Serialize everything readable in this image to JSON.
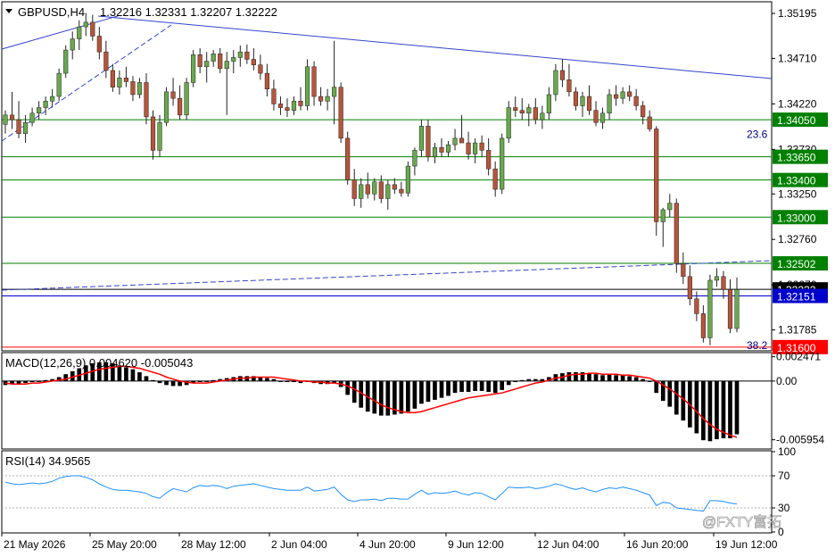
{
  "header": {
    "symbol_tf": "GBPUSD,H4",
    "ohlc": "1.32216 1.32331 1.32207 1.32222"
  },
  "watermark": {
    "text": "@FXTY富拓"
  },
  "chart_data": [
    {
      "type": "candlestick",
      "symbol": "GBPUSD",
      "timeframe": "H4",
      "open": 1.32216,
      "high": 1.32331,
      "low": 1.32207,
      "close": 1.32222,
      "ylim": [
        1.3156,
        1.3532
      ],
      "price_axis_ticks": [
        "1.35195",
        "1.34710",
        "1.34220",
        "1.33730",
        "1.33250",
        "1.32760",
        "1.32270",
        "1.31785"
      ],
      "time_axis_labels": [
        "21 May 2026",
        "25 May 20:00",
        "28 May 12:00",
        "2 Jun 04:00",
        "4 Jun 20:00",
        "9 Jun 12:00",
        "12 Jun 04:00",
        "16 Jun 20:00",
        "19 Jun 12:00"
      ],
      "candles": [
        {
          "o": 1.34,
          "h": 1.3415,
          "l": 1.339,
          "c": 1.341
        },
        {
          "o": 1.341,
          "h": 1.3435,
          "l": 1.3395,
          "c": 1.3405
        },
        {
          "o": 1.3405,
          "h": 1.3425,
          "l": 1.3385,
          "c": 1.339
        },
        {
          "o": 1.339,
          "h": 1.341,
          "l": 1.338,
          "c": 1.3402
        },
        {
          "o": 1.3402,
          "h": 1.3418,
          "l": 1.3398,
          "c": 1.3412
        },
        {
          "o": 1.3412,
          "h": 1.3425,
          "l": 1.3405,
          "c": 1.3418
        },
        {
          "o": 1.3418,
          "h": 1.343,
          "l": 1.341,
          "c": 1.3425
        },
        {
          "o": 1.3425,
          "h": 1.3438,
          "l": 1.3418,
          "c": 1.343
        },
        {
          "o": 1.343,
          "h": 1.346,
          "l": 1.3425,
          "c": 1.3455
        },
        {
          "o": 1.3455,
          "h": 1.3485,
          "l": 1.345,
          "c": 1.348
        },
        {
          "o": 1.348,
          "h": 1.35,
          "l": 1.347,
          "c": 1.3492
        },
        {
          "o": 1.3492,
          "h": 1.3512,
          "l": 1.348,
          "c": 1.3505
        },
        {
          "o": 1.3505,
          "h": 1.352,
          "l": 1.3495,
          "c": 1.351
        },
        {
          "o": 1.351,
          "h": 1.3518,
          "l": 1.349,
          "c": 1.3495
        },
        {
          "o": 1.3495,
          "h": 1.3505,
          "l": 1.347,
          "c": 1.3478
        },
        {
          "o": 1.3478,
          "h": 1.349,
          "l": 1.345,
          "c": 1.3458
        },
        {
          "o": 1.3458,
          "h": 1.3465,
          "l": 1.3435,
          "c": 1.344
        },
        {
          "o": 1.344,
          "h": 1.3458,
          "l": 1.3432,
          "c": 1.345
        },
        {
          "o": 1.345,
          "h": 1.3462,
          "l": 1.344,
          "c": 1.3446
        },
        {
          "o": 1.3446,
          "h": 1.3452,
          "l": 1.3425,
          "c": 1.3432
        },
        {
          "o": 1.3432,
          "h": 1.345,
          "l": 1.3428,
          "c": 1.3445
        },
        {
          "o": 1.3445,
          "h": 1.3455,
          "l": 1.34,
          "c": 1.3408
        },
        {
          "o": 1.3408,
          "h": 1.3415,
          "l": 1.3362,
          "c": 1.3372
        },
        {
          "o": 1.3372,
          "h": 1.341,
          "l": 1.3365,
          "c": 1.3402
        },
        {
          "o": 1.3402,
          "h": 1.344,
          "l": 1.3398,
          "c": 1.3435
        },
        {
          "o": 1.3435,
          "h": 1.345,
          "l": 1.342,
          "c": 1.3428
        },
        {
          "o": 1.3428,
          "h": 1.3442,
          "l": 1.3405,
          "c": 1.341
        },
        {
          "o": 1.341,
          "h": 1.345,
          "l": 1.3405,
          "c": 1.3445
        },
        {
          "o": 1.3445,
          "h": 1.348,
          "l": 1.344,
          "c": 1.3475
        },
        {
          "o": 1.3475,
          "h": 1.3482,
          "l": 1.3455,
          "c": 1.3462
        },
        {
          "o": 1.3462,
          "h": 1.3478,
          "l": 1.3445,
          "c": 1.3468
        },
        {
          "o": 1.3468,
          "h": 1.348,
          "l": 1.3462,
          "c": 1.3476
        },
        {
          "o": 1.3476,
          "h": 1.3482,
          "l": 1.3455,
          "c": 1.346
        },
        {
          "o": 1.346,
          "h": 1.3478,
          "l": 1.341,
          "c": 1.3468
        },
        {
          "o": 1.3468,
          "h": 1.348,
          "l": 1.3455,
          "c": 1.3472
        },
        {
          "o": 1.3472,
          "h": 1.3485,
          "l": 1.3462,
          "c": 1.3478
        },
        {
          "o": 1.3478,
          "h": 1.3486,
          "l": 1.3465,
          "c": 1.347
        },
        {
          "o": 1.347,
          "h": 1.3482,
          "l": 1.3458,
          "c": 1.3464
        },
        {
          "o": 1.3464,
          "h": 1.3475,
          "l": 1.3448,
          "c": 1.3455
        },
        {
          "o": 1.3455,
          "h": 1.3465,
          "l": 1.343,
          "c": 1.3438
        },
        {
          "o": 1.3438,
          "h": 1.3448,
          "l": 1.3415,
          "c": 1.3422
        },
        {
          "o": 1.3422,
          "h": 1.343,
          "l": 1.341,
          "c": 1.3418
        },
        {
          "o": 1.3418,
          "h": 1.3428,
          "l": 1.3408,
          "c": 1.3415
        },
        {
          "o": 1.3415,
          "h": 1.343,
          "l": 1.341,
          "c": 1.3425
        },
        {
          "o": 1.3425,
          "h": 1.344,
          "l": 1.3415,
          "c": 1.342
        },
        {
          "o": 1.342,
          "h": 1.347,
          "l": 1.3415,
          "c": 1.3462
        },
        {
          "o": 1.3462,
          "h": 1.3468,
          "l": 1.342,
          "c": 1.343
        },
        {
          "o": 1.343,
          "h": 1.344,
          "l": 1.342,
          "c": 1.3425
        },
        {
          "o": 1.3425,
          "h": 1.3438,
          "l": 1.3415,
          "c": 1.343
        },
        {
          "o": 1.343,
          "h": 1.349,
          "l": 1.34,
          "c": 1.344
        },
        {
          "o": 1.344,
          "h": 1.3445,
          "l": 1.338,
          "c": 1.3385
        },
        {
          "o": 1.3385,
          "h": 1.3392,
          "l": 1.3335,
          "c": 1.334
        },
        {
          "o": 1.334,
          "h": 1.3352,
          "l": 1.3312,
          "c": 1.332
        },
        {
          "o": 1.332,
          "h": 1.3342,
          "l": 1.331,
          "c": 1.3335
        },
        {
          "o": 1.3335,
          "h": 1.3348,
          "l": 1.332,
          "c": 1.3325
        },
        {
          "o": 1.3325,
          "h": 1.3342,
          "l": 1.3318,
          "c": 1.3338
        },
        {
          "o": 1.3338,
          "h": 1.3345,
          "l": 1.3315,
          "c": 1.332
        },
        {
          "o": 1.332,
          "h": 1.334,
          "l": 1.3308,
          "c": 1.3335
        },
        {
          "o": 1.3335,
          "h": 1.3342,
          "l": 1.3325,
          "c": 1.333
        },
        {
          "o": 1.333,
          "h": 1.3338,
          "l": 1.3322,
          "c": 1.3326
        },
        {
          "o": 1.3326,
          "h": 1.336,
          "l": 1.3322,
          "c": 1.3355
        },
        {
          "o": 1.3355,
          "h": 1.3375,
          "l": 1.3345,
          "c": 1.3372
        },
        {
          "o": 1.3372,
          "h": 1.3405,
          "l": 1.3365,
          "c": 1.3398
        },
        {
          "o": 1.3398,
          "h": 1.3405,
          "l": 1.336,
          "c": 1.3365
        },
        {
          "o": 1.3365,
          "h": 1.338,
          "l": 1.3358,
          "c": 1.3375
        },
        {
          "o": 1.3375,
          "h": 1.3385,
          "l": 1.3365,
          "c": 1.337
        },
        {
          "o": 1.337,
          "h": 1.3382,
          "l": 1.3365,
          "c": 1.3378
        },
        {
          "o": 1.3378,
          "h": 1.3395,
          "l": 1.3372,
          "c": 1.3385
        },
        {
          "o": 1.3385,
          "h": 1.341,
          "l": 1.338,
          "c": 1.338
        },
        {
          "o": 1.338,
          "h": 1.3392,
          "l": 1.3362,
          "c": 1.3368
        },
        {
          "o": 1.3368,
          "h": 1.3385,
          "l": 1.3358,
          "c": 1.338
        },
        {
          "o": 1.338,
          "h": 1.3388,
          "l": 1.3365,
          "c": 1.3372
        },
        {
          "o": 1.3372,
          "h": 1.3385,
          "l": 1.3345,
          "c": 1.3352
        },
        {
          "o": 1.3352,
          "h": 1.336,
          "l": 1.3322,
          "c": 1.333
        },
        {
          "o": 1.333,
          "h": 1.339,
          "l": 1.3325,
          "c": 1.3385
        },
        {
          "o": 1.3385,
          "h": 1.3425,
          "l": 1.338,
          "c": 1.3418
        },
        {
          "o": 1.3418,
          "h": 1.343,
          "l": 1.3408,
          "c": 1.3415
        },
        {
          "o": 1.3415,
          "h": 1.3428,
          "l": 1.3405,
          "c": 1.3412
        },
        {
          "o": 1.3412,
          "h": 1.3422,
          "l": 1.3398,
          "c": 1.3418
        },
        {
          "o": 1.3418,
          "h": 1.3428,
          "l": 1.34,
          "c": 1.3405
        },
        {
          "o": 1.3405,
          "h": 1.342,
          "l": 1.3395,
          "c": 1.3412
        },
        {
          "o": 1.3412,
          "h": 1.344,
          "l": 1.3405,
          "c": 1.3432
        },
        {
          "o": 1.3432,
          "h": 1.3465,
          "l": 1.3425,
          "c": 1.3458
        },
        {
          "o": 1.3458,
          "h": 1.347,
          "l": 1.344,
          "c": 1.3448
        },
        {
          "o": 1.3448,
          "h": 1.3465,
          "l": 1.343,
          "c": 1.3435
        },
        {
          "o": 1.3435,
          "h": 1.344,
          "l": 1.3415,
          "c": 1.342
        },
        {
          "o": 1.342,
          "h": 1.3435,
          "l": 1.3408,
          "c": 1.343
        },
        {
          "o": 1.343,
          "h": 1.3442,
          "l": 1.341,
          "c": 1.3415
        },
        {
          "o": 1.3415,
          "h": 1.3425,
          "l": 1.3398,
          "c": 1.3402
        },
        {
          "o": 1.3402,
          "h": 1.3418,
          "l": 1.3395,
          "c": 1.3412
        },
        {
          "o": 1.3412,
          "h": 1.3438,
          "l": 1.3405,
          "c": 1.3432
        },
        {
          "o": 1.3432,
          "h": 1.3442,
          "l": 1.342,
          "c": 1.3428
        },
        {
          "o": 1.3428,
          "h": 1.344,
          "l": 1.3422,
          "c": 1.3435
        },
        {
          "o": 1.3435,
          "h": 1.3442,
          "l": 1.3425,
          "c": 1.343
        },
        {
          "o": 1.343,
          "h": 1.3438,
          "l": 1.3415,
          "c": 1.342
        },
        {
          "o": 1.342,
          "h": 1.3425,
          "l": 1.34,
          "c": 1.3408
        },
        {
          "o": 1.3408,
          "h": 1.3415,
          "l": 1.3392,
          "c": 1.3395
        },
        {
          "o": 1.3395,
          "h": 1.3398,
          "l": 1.328,
          "c": 1.3295
        },
        {
          "o": 1.3295,
          "h": 1.331,
          "l": 1.3268,
          "c": 1.3308
        },
        {
          "o": 1.3308,
          "h": 1.3325,
          "l": 1.33,
          "c": 1.3315
        },
        {
          "o": 1.3315,
          "h": 1.332,
          "l": 1.324,
          "c": 1.325
        },
        {
          "o": 1.325,
          "h": 1.3262,
          "l": 1.3228,
          "c": 1.3236
        },
        {
          "o": 1.3236,
          "h": 1.3248,
          "l": 1.3205,
          "c": 1.3212
        },
        {
          "o": 1.3212,
          "h": 1.322,
          "l": 1.3188,
          "c": 1.3196
        },
        {
          "o": 1.3196,
          "h": 1.3205,
          "l": 1.3165,
          "c": 1.317
        },
        {
          "o": 1.317,
          "h": 1.3238,
          "l": 1.3162,
          "c": 1.3232
        },
        {
          "o": 1.3232,
          "h": 1.3245,
          "l": 1.3225,
          "c": 1.3236
        },
        {
          "o": 1.3236,
          "h": 1.3242,
          "l": 1.3212,
          "c": 1.3222
        },
        {
          "o": 1.3222,
          "h": 1.3233,
          "l": 1.3175,
          "c": 1.318
        },
        {
          "o": 1.318,
          "h": 1.3235,
          "l": 1.3176,
          "c": 1.3222
        }
      ],
      "horizontal_levels": [
        {
          "price": 1.3405,
          "label": "1.34050",
          "color": "#008000"
        },
        {
          "price": 1.3365,
          "label": "1.33650",
          "color": "#008000"
        },
        {
          "price": 1.334,
          "label": "1.33400",
          "color": "#008000"
        },
        {
          "price": 1.33,
          "label": "1.33000",
          "color": "#008000"
        },
        {
          "price": 1.32502,
          "label": "1.32502",
          "color": "#008000"
        },
        {
          "price": 1.32222,
          "label": "1.32222",
          "color": "#000000"
        },
        {
          "price": 1.32151,
          "label": "1.32151",
          "color": "#0000cc"
        },
        {
          "price": 1.316,
          "label": "1.31600",
          "color": "#ff0000"
        }
      ],
      "fib_labels": [
        {
          "text": "23.6",
          "price": 1.3389
        },
        {
          "text": "38.2",
          "price": 1.3156
        }
      ],
      "colors": {
        "bull": "#6aa84f",
        "bear": "#b5553a",
        "trend": "#3344cc"
      }
    },
    {
      "type": "macd",
      "title": "MACD(12,26,9) 0.004620 -0.005043",
      "axis_labels": [
        "0.002471",
        "0.00",
        "-0.005954"
      ],
      "ylim": [
        -0.0068,
        0.0028
      ],
      "histogram": [
        -0.0004,
        -0.0003,
        -0.0003,
        -0.0002,
        -0.0001,
        0.0,
        0.0001,
        0.0002,
        0.0004,
        0.0007,
        0.001,
        0.0013,
        0.0016,
        0.0018,
        0.0019,
        0.0019,
        0.0018,
        0.0016,
        0.0014,
        0.0012,
        0.0009,
        0.0005,
        0.0001,
        -0.0002,
        -0.0004,
        -0.0005,
        -0.0005,
        -0.0004,
        -0.0002,
        -0.0001,
        0.0,
        0.0001,
        0.0002,
        0.0003,
        0.0004,
        0.0005,
        0.0005,
        0.0005,
        0.0004,
        0.0003,
        0.0002,
        0.0,
        -0.0001,
        -0.0001,
        -0.0002,
        -0.0001,
        -0.0002,
        -0.0003,
        -0.0003,
        -0.0002,
        -0.0006,
        -0.0014,
        -0.0022,
        -0.0027,
        -0.0031,
        -0.0033,
        -0.0035,
        -0.0035,
        -0.0034,
        -0.0033,
        -0.0031,
        -0.0028,
        -0.0023,
        -0.0021,
        -0.0019,
        -0.0017,
        -0.0015,
        -0.0012,
        -0.0011,
        -0.0011,
        -0.001,
        -0.001,
        -0.0011,
        -0.0012,
        -0.0009,
        -0.0004,
        -0.0001,
        0.0001,
        0.0002,
        0.0002,
        0.0002,
        0.0004,
        0.0007,
        0.0008,
        0.0009,
        0.0009,
        0.0009,
        0.0008,
        0.0007,
        0.0006,
        0.0007,
        0.0006,
        0.0006,
        0.0005,
        0.0004,
        0.0002,
        0.0,
        -0.0012,
        -0.002,
        -0.0026,
        -0.0034,
        -0.004,
        -0.0047,
        -0.0053,
        -0.006,
        -0.0061,
        -0.0059,
        -0.0058,
        -0.0058,
        -0.0054
      ],
      "signal": [
        -0.0002,
        -0.0003,
        -0.0003,
        -0.0003,
        -0.0002,
        -0.0002,
        -0.0001,
        0.0,
        0.0001,
        0.0002,
        0.0004,
        0.0006,
        0.0008,
        0.001,
        0.0012,
        0.0013,
        0.0014,
        0.0015,
        0.0015,
        0.0014,
        0.0013,
        0.0011,
        0.0009,
        0.0007,
        0.0004,
        0.0002,
        -0.0,
        -0.0001,
        -0.0002,
        -0.0002,
        -0.0002,
        -0.0001,
        -0.0,
        0.0001,
        0.0002,
        0.0003,
        0.0003,
        0.0004,
        0.0004,
        0.0004,
        0.0004,
        0.0003,
        0.0002,
        0.0001,
        0.0,
        -0.0,
        -0.0001,
        -0.0001,
        -0.0002,
        -0.0002,
        -0.0003,
        -0.0005,
        -0.0008,
        -0.0012,
        -0.0016,
        -0.002,
        -0.0024,
        -0.0027,
        -0.0029,
        -0.0031,
        -0.0032,
        -0.0032,
        -0.0031,
        -0.0029,
        -0.0027,
        -0.0025,
        -0.0023,
        -0.0021,
        -0.0019,
        -0.0017,
        -0.0016,
        -0.0015,
        -0.0014,
        -0.0013,
        -0.0012,
        -0.001,
        -0.0008,
        -0.0006,
        -0.0004,
        -0.0002,
        -0.0001,
        0.0001,
        0.0003,
        0.0004,
        0.0006,
        0.0007,
        0.0007,
        0.0008,
        0.0008,
        0.0007,
        0.0007,
        0.0007,
        0.0006,
        0.0006,
        0.0005,
        0.0004,
        0.0003,
        0.0,
        -0.0004,
        -0.0008,
        -0.0013,
        -0.0018,
        -0.0024,
        -0.0031,
        -0.0038,
        -0.0044,
        -0.0049,
        -0.0052,
        -0.0055,
        -0.0057
      ],
      "colors": {
        "histogram": "#000000",
        "signal": "#ff0000"
      }
    },
    {
      "type": "line",
      "title": "RSI(14) 34.9565",
      "axis_labels": [
        "100",
        "70",
        "30",
        "0"
      ],
      "ylim": [
        0,
        100
      ],
      "values": [
        62,
        60,
        59,
        60,
        61,
        60,
        61,
        63,
        67,
        69,
        70,
        70,
        68,
        65,
        60,
        56,
        53,
        52,
        52,
        51,
        50,
        48,
        44,
        42,
        49,
        54,
        52,
        50,
        55,
        58,
        57,
        58,
        57,
        54,
        57,
        58,
        59,
        60,
        58,
        56,
        54,
        53,
        52,
        52,
        52,
        56,
        51,
        52,
        53,
        56,
        47,
        40,
        38,
        40,
        40,
        41,
        39,
        42,
        42,
        41,
        41,
        47,
        52,
        47,
        49,
        48,
        49,
        51,
        48,
        46,
        49,
        48,
        44,
        40,
        48,
        56,
        55,
        55,
        56,
        54,
        55,
        57,
        60,
        58,
        55,
        53,
        55,
        52,
        50,
        53,
        55,
        54,
        56,
        54,
        52,
        49,
        46,
        33,
        37,
        36,
        30,
        29,
        28,
        27,
        26,
        39,
        39,
        38,
        36,
        35
      ],
      "colors": {
        "line": "#1e90ff"
      }
    }
  ]
}
